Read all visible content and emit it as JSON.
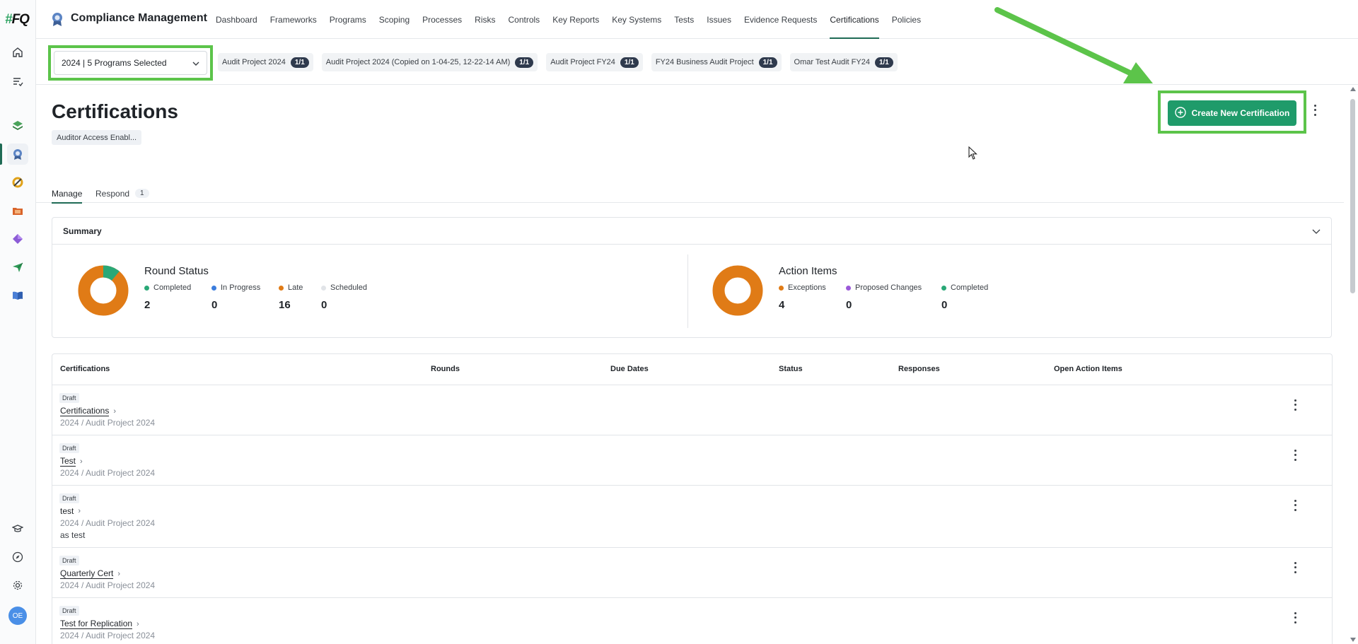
{
  "app": {
    "title": "Compliance Management"
  },
  "nav": [
    {
      "label": "Dashboard"
    },
    {
      "label": "Frameworks"
    },
    {
      "label": "Programs"
    },
    {
      "label": "Scoping"
    },
    {
      "label": "Processes"
    },
    {
      "label": "Risks"
    },
    {
      "label": "Controls"
    },
    {
      "label": "Key Reports"
    },
    {
      "label": "Key Systems"
    },
    {
      "label": "Tests"
    },
    {
      "label": "Issues"
    },
    {
      "label": "Evidence Requests"
    },
    {
      "label": "Certifications",
      "active": true
    },
    {
      "label": "Policies"
    }
  ],
  "rail": {
    "logo_hash": "#",
    "logo_text": "FQ",
    "avatar_initials": "OE"
  },
  "program_select": {
    "value": "2024 | 5 Programs Selected"
  },
  "program_chips": [
    {
      "label": "Audit Project 2024",
      "count": "1/1"
    },
    {
      "label": "Audit Project 2024 (Copied on 1-04-25, 12-22-14 AM)",
      "count": "1/1"
    },
    {
      "label": "Audit Project FY24",
      "count": "1/1"
    },
    {
      "label": "FY24 Business Audit Project",
      "count": "1/1"
    },
    {
      "label": "Omar Test Audit FY24",
      "count": "1/1"
    }
  ],
  "page": {
    "title": "Certifications",
    "access_chip": "Auditor Access Enabl...",
    "create_button": "Create New Certification"
  },
  "tabs": {
    "manage": "Manage",
    "respond": "Respond",
    "respond_count": "1"
  },
  "summary": {
    "title": "Summary",
    "round_status": {
      "title": "Round Status",
      "items": [
        {
          "label": "Completed",
          "value": "2",
          "color": "#2aa877"
        },
        {
          "label": "In Progress",
          "value": "0",
          "color": "#3b7ddd"
        },
        {
          "label": "Late",
          "value": "16",
          "color": "#e07b16"
        },
        {
          "label": "Scheduled",
          "value": "0",
          "color": "#e1e4e8"
        }
      ]
    },
    "action_items": {
      "title": "Action Items",
      "items": [
        {
          "label": "Exceptions",
          "value": "4",
          "color": "#e07b16"
        },
        {
          "label": "Proposed Changes",
          "value": "0",
          "color": "#9b59d9"
        },
        {
          "label": "Completed",
          "value": "0",
          "color": "#2aa877"
        }
      ]
    }
  },
  "table": {
    "headers": {
      "certifications": "Certifications",
      "rounds": "Rounds",
      "due_dates": "Due Dates",
      "status": "Status",
      "responses": "Responses",
      "open_action_items": "Open Action Items"
    },
    "rows": [
      {
        "status": "Draft",
        "name": "Certifications",
        "sub": "2024 / Audit Project 2024",
        "desc": ""
      },
      {
        "status": "Draft",
        "name": "Test",
        "sub": "2024 / Audit Project 2024",
        "desc": ""
      },
      {
        "status": "Draft",
        "name": "test",
        "sub": "2024 / Audit Project 2024",
        "desc": "as test"
      },
      {
        "status": "Draft",
        "name": "Quarterly Cert",
        "sub": "2024 / Audit Project 2024",
        "desc": ""
      },
      {
        "status": "Draft",
        "name": "Test for Replication",
        "sub": "2024 / Audit Project 2024",
        "desc": ""
      }
    ]
  }
}
